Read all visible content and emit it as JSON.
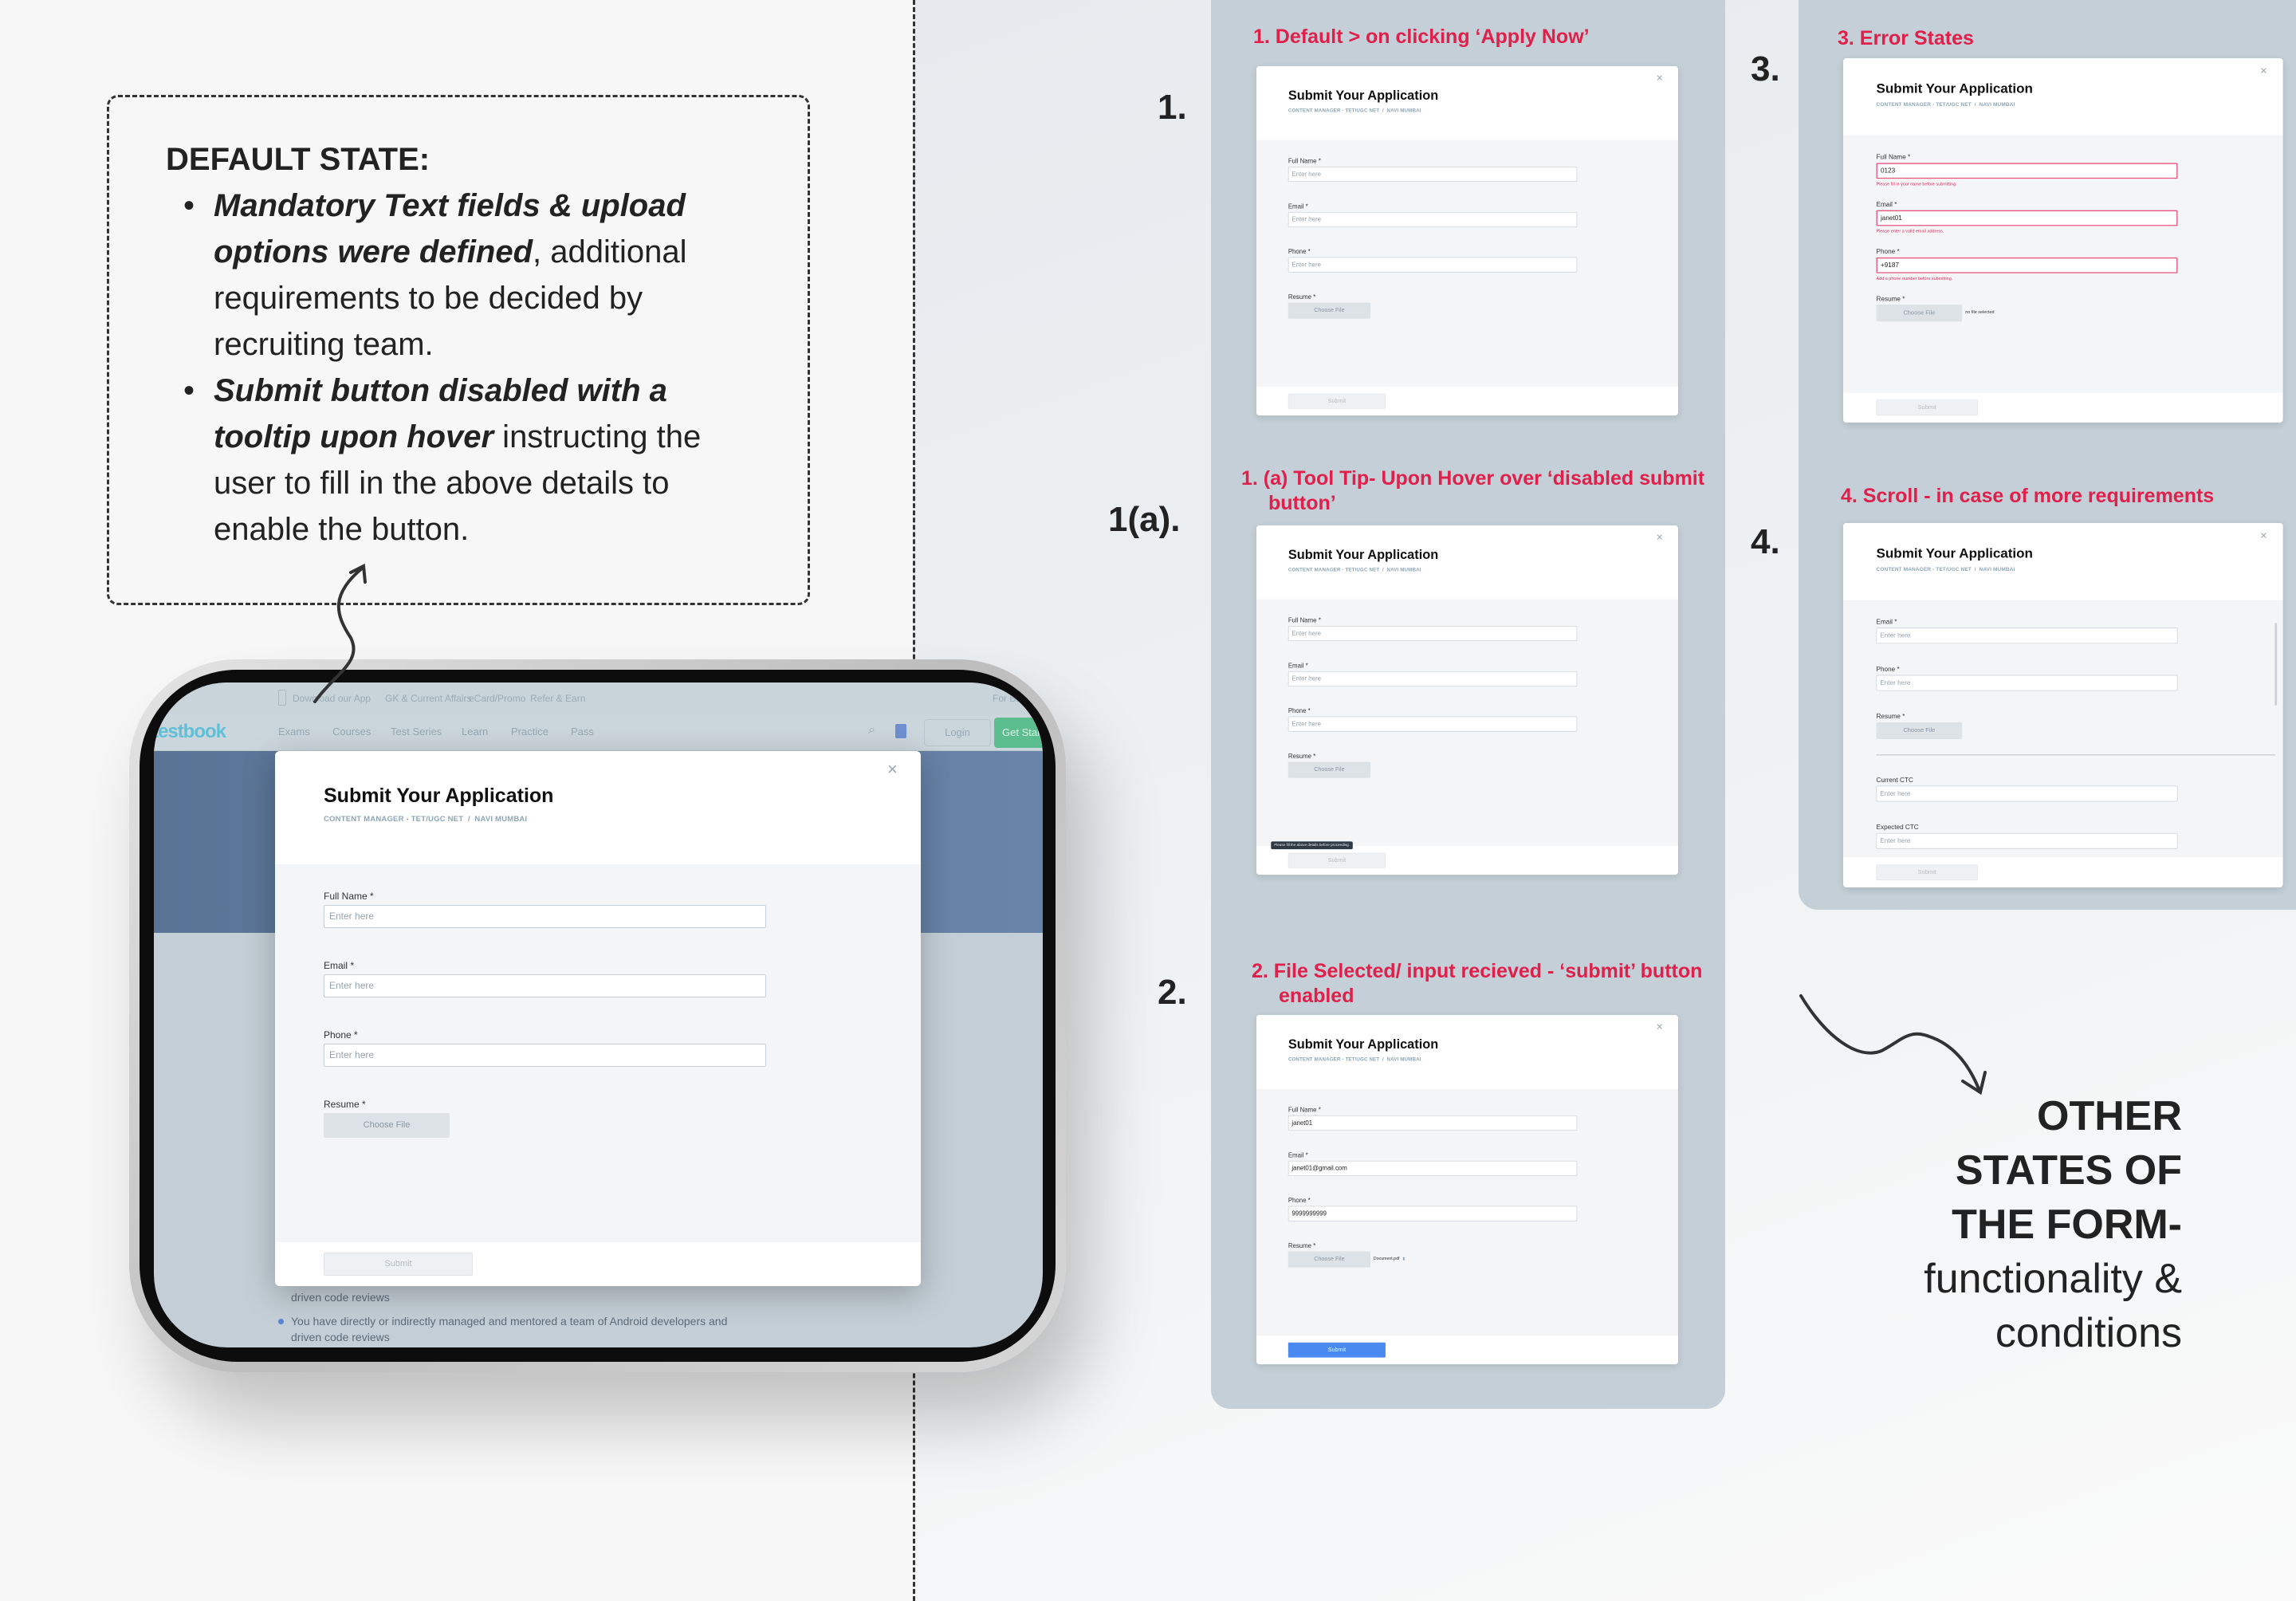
{
  "left_note": {
    "title": "DEFAULT STATE:",
    "bullets": [
      {
        "em": "Mandatory Text fields & upload options were defined",
        "rest": ", additional requirements to be decided by recruiting team."
      },
      {
        "em": "Submit button disabled with a tooltip upon hover",
        "rest": " instructing the user to fill in the above details to enable the button."
      }
    ]
  },
  "tablet_page": {
    "top_links": [
      "Download our App",
      "GK & Current Affairs",
      "eCard/Promo",
      "Refer & Earn",
      "For Business"
    ],
    "logo": "testbook",
    "nav": [
      "Exams",
      "Courses",
      "Test Series",
      "Learn",
      "Practice",
      "Pass"
    ],
    "login": "Login",
    "get_started": "Get Started",
    "body_lines": [
      "driven code reviews",
      "You have directly or indirectly managed and mentored a team of Android developers and",
      "driven code reviews"
    ]
  },
  "form": {
    "title": "Submit Your Application",
    "subtitle": "CONTENT MANAGER - TET/UGC NET  /  NAVI MUMBAI",
    "close": "×",
    "fields": [
      "Full Name *",
      "Email *",
      "Phone *"
    ],
    "resume_label": "Resume *",
    "choose_file": "Choose File",
    "placeholder": "Enter here",
    "submit": "Submit",
    "extra_fields": [
      "Current CTC",
      "Expected CTC"
    ]
  },
  "states": [
    {
      "number": "1.",
      "heading": "1. Default > on clicking ‘Apply Now’"
    },
    {
      "number": "1(a).",
      "heading": "1.  (a) Tool Tip- Upon Hover over ‘disabled submit button’",
      "tooltip": "Please fill the above details before proceeding."
    },
    {
      "number": "2.",
      "heading": "2. File Selected/ input recieved - ‘submit’ button enabled",
      "values": [
        "janet01",
        "janet01@gmail.com",
        "9999999999"
      ],
      "file": "Document.pdf"
    },
    {
      "number": "3.",
      "heading": "3. Error States",
      "values": [
        "0123",
        "janet01",
        "+9187"
      ],
      "errors": [
        "Please fill in your name before submitting.",
        "Please enter a valid email address.",
        "Add a phone number before submitting."
      ],
      "file": "no file selected"
    },
    {
      "number": "4.",
      "heading": "4. Scroll - in case of more requirements"
    }
  ],
  "summary": {
    "bold_lines": [
      "OTHER",
      "STATES OF",
      "THE FORM-"
    ],
    "lines": [
      "functionality &",
      "conditions"
    ]
  },
  "colors": {
    "accent_red": "#e0204a",
    "submit_blue": "#4a8af0",
    "error_pink": "#e8557d",
    "brand": "#5fbfd6",
    "get_started_green": "#5cbe8e"
  }
}
